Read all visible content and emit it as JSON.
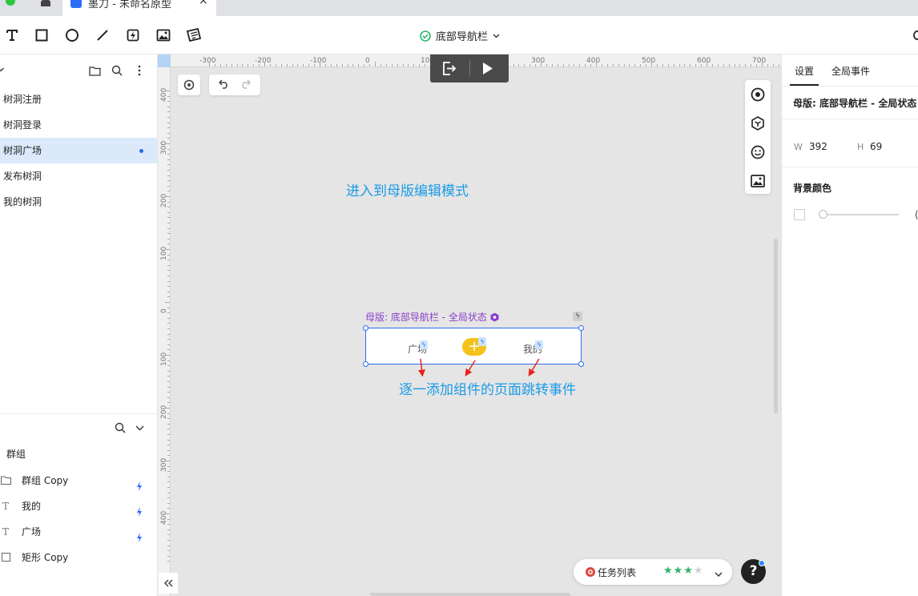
{
  "browser": {
    "tab_title": "墨刀 - 未命名原型",
    "tab_close": "×"
  },
  "toolbar": {
    "page_name": "底部导航栏",
    "tools": [
      "text-tool",
      "rectangle-tool",
      "ellipse-tool",
      "line-tool",
      "hotspot-tool",
      "image-tool",
      "sticky-note-tool"
    ]
  },
  "pages": {
    "items": [
      {
        "label": "树洞注册",
        "active": false
      },
      {
        "label": "树洞登录",
        "active": false
      },
      {
        "label": "树洞广场",
        "active": true
      },
      {
        "label": "发布树洞",
        "active": false
      },
      {
        "label": "我的树洞",
        "active": false
      }
    ]
  },
  "layers": {
    "group_label": "群组",
    "items": [
      {
        "label": "群组 Copy",
        "icon": "folder-icon",
        "has_event": true
      },
      {
        "label": "我的",
        "icon": "text-icon",
        "has_event": true
      },
      {
        "label": "广场",
        "icon": "text-icon",
        "has_event": true
      },
      {
        "label": "矩形 Copy",
        "icon": "rectangle-icon",
        "has_event": false
      }
    ]
  },
  "rulers": {
    "top": [
      "-300",
      "-200",
      "-100",
      "0",
      "100",
      "200",
      "300",
      "400",
      "500",
      "600",
      "700"
    ],
    "left": [
      "400",
      "300",
      "200",
      "100",
      "0",
      "100",
      "200",
      "300",
      "400"
    ]
  },
  "canvas": {
    "note_top": "进入到母版编辑模式",
    "note_bottom": "逐一添加组件的页面跳转事件",
    "master_label": "母版: 底部导航栏 - 全局状态",
    "nav": {
      "left": "广场",
      "center": "+",
      "right": "我的"
    }
  },
  "tasks": {
    "label": "任务列表",
    "rating": 3,
    "max_rating": 4,
    "help": "?"
  },
  "right_panel": {
    "tabs": [
      "设置",
      "全局事件"
    ],
    "active_tab": "设置",
    "master_title": "母版: 底部导航栏 - 全局状态",
    "width_label": "W",
    "width_value": "392",
    "height_label": "H",
    "height_value": "69",
    "bg_color_label": "背景颜色",
    "opacity_clip": "("
  },
  "colors": {
    "accent": "#2b6cf6",
    "annotation": "#1a9be6",
    "master_purple": "#8a40c9",
    "plus_yellow": "#f4c21a",
    "active_page_bg": "#dbe9fb"
  }
}
